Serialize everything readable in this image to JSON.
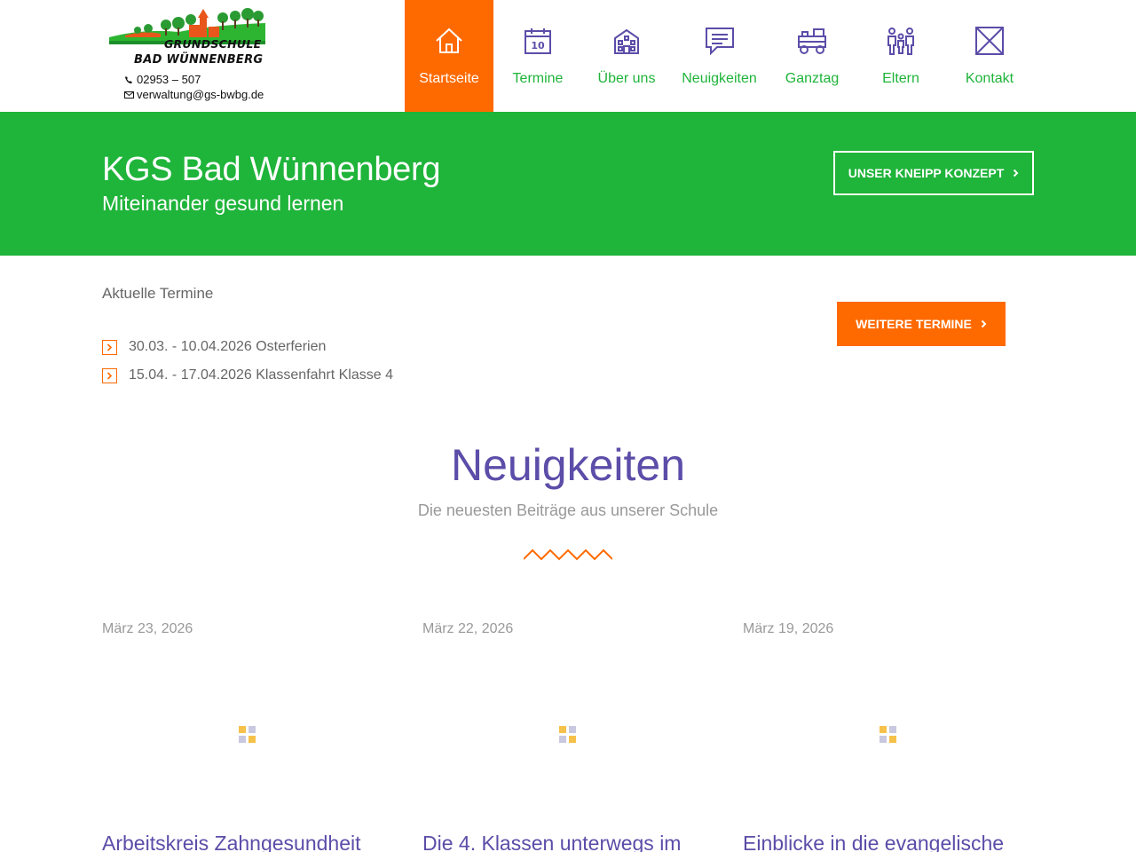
{
  "logo": {
    "line1": "GRUNDSCHULE",
    "line2": "BAD WÜNNENBERG",
    "phone": "02953 – 507",
    "email": "verwaltung@gs-bwbg.de"
  },
  "nav": [
    {
      "label": "Startseite",
      "icon": "home-icon",
      "active": true
    },
    {
      "label": "Termine",
      "icon": "calendar-icon"
    },
    {
      "label": "Über uns",
      "icon": "school-building-icon"
    },
    {
      "label": "Neuigkeiten",
      "icon": "speech-bubble-icon"
    },
    {
      "label": "Ganztag",
      "icon": "toy-train-icon"
    },
    {
      "label": "Eltern",
      "icon": "family-icon"
    },
    {
      "label": "Kontakt",
      "icon": "envelope-icon"
    }
  ],
  "calendar_icon_number": "10",
  "banner": {
    "title": "KGS Bad Wünnenberg",
    "subtitle": "Miteinander gesund lernen",
    "button": "UNSER KNEIPP KONZEPT"
  },
  "termine": {
    "title": "Aktuelle Termine",
    "items": [
      "30.03. - 10.04.2026 Osterferien",
      "15.04. - 17.04.2026 Klassenfahrt Klasse 4"
    ],
    "button": "WEITERE TERMINE"
  },
  "news": {
    "heading": "Neuigkeiten",
    "subheading": "Die neuesten Beiträge aus unserer Schule",
    "cards": [
      {
        "date": "März 23, 2026",
        "title": "Arbeitskreis Zahngesundheit"
      },
      {
        "date": "März 22, 2026",
        "title": "Die 4. Klassen unterwegs im"
      },
      {
        "date": "März 19, 2026",
        "title": "Einblicke in die evangelische"
      }
    ]
  },
  "colors": {
    "green": "#1fb43a",
    "orange": "#ff6a00",
    "purple": "#5b4da8"
  }
}
